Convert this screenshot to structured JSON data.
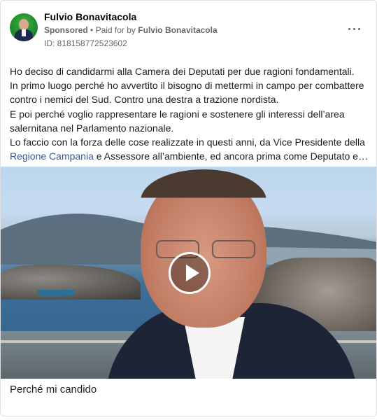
{
  "advertiser": {
    "name": "Fulvio Bonavitacola",
    "sponsored_label": "Sponsored",
    "separator": "•",
    "paid_for_prefix": "Paid for by",
    "payer": "Fulvio Bonavitacola",
    "ad_id": "ID: 818158772523602"
  },
  "menu": {
    "more_icon": "more-horizontal-icon"
  },
  "body": {
    "line1": "Ho deciso di candidarmi alla Camera dei Deputati per due ragioni fondamentali.",
    "line2": "In primo luogo perché ho avvertito il bisogno di mettermi in campo per combattere",
    "line3": "contro i nemici del Sud. Contro una destra a trazione nordista.",
    "line4": "E poi perché voglio rappresentare le ragioni e sostenere gli interessi dell’area",
    "line5": "salernitana nel Parlamento nazionale.",
    "line6": "Lo faccio con la forza delle cose realizzate in questi anni, da Vice Presidente della",
    "line7_link": "Regione Campania",
    "line7_rest": " e Assessore all’ambiente, ed ancora prima come Deputato e…"
  },
  "video": {
    "play_icon": "play-icon"
  },
  "caption": "Perché mi candido",
  "colors": {
    "link": "#385898",
    "meta": "#65676b",
    "avatar_bg": "#1f8a2e"
  }
}
